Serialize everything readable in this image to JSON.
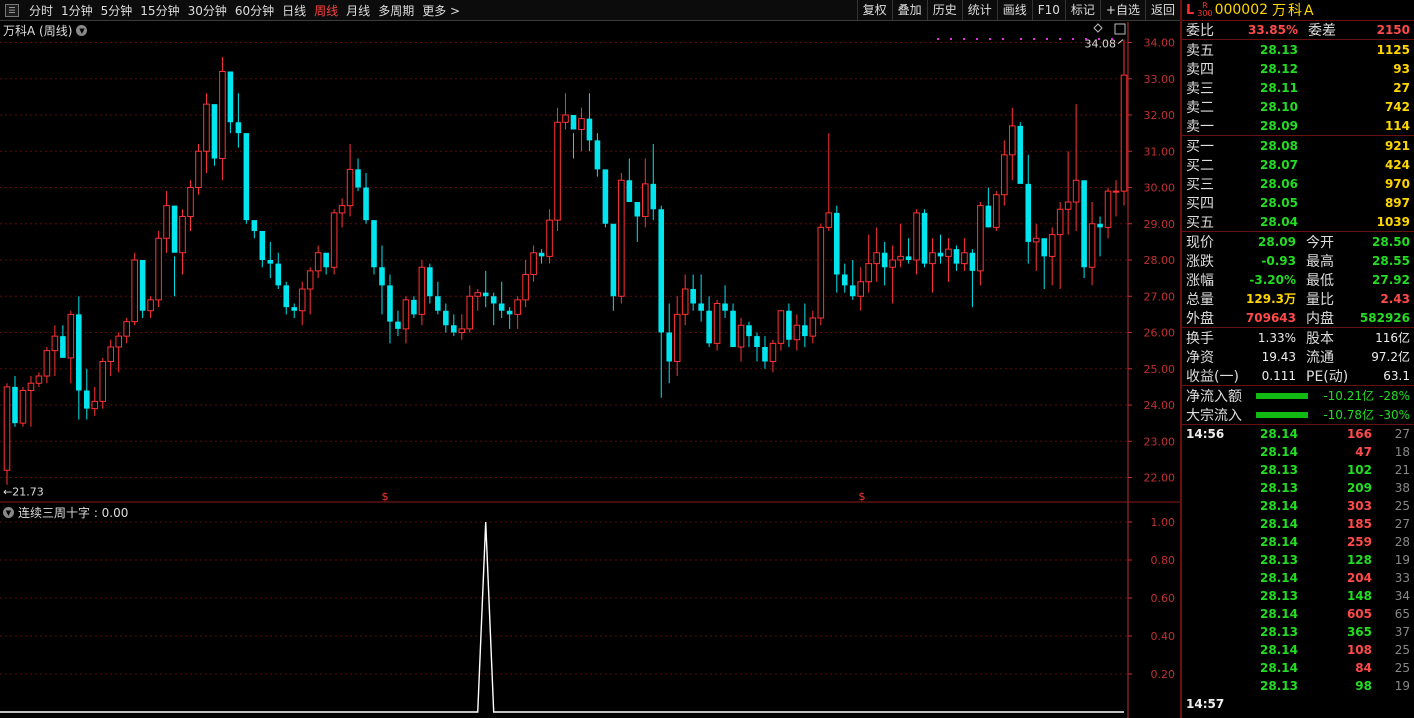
{
  "toolbar": {
    "periods": [
      "分时",
      "1分钟",
      "5分钟",
      "15分钟",
      "30分钟",
      "60分钟",
      "日线",
      "周线",
      "月线",
      "多周期",
      "更多 >"
    ],
    "active_period": 7,
    "tools": [
      "复权",
      "叠加",
      "历史",
      "统计",
      "画线",
      "F10",
      "标记",
      "+自选",
      "返回"
    ]
  },
  "chart": {
    "title": "万科A (周线)",
    "high_label": "34.08",
    "low_label": "←21.73",
    "marker": "$",
    "indicator_title": "连续三周十字 : 0.00"
  },
  "colors": {
    "up": "#ff3333",
    "down": "#00e5ee",
    "grid": "#5a0c0c",
    "axis": "#c03030",
    "ind_line": "#ffffff"
  },
  "chart_data": [
    {
      "type": "candlestick",
      "yticks": [
        "34.00",
        "33.00",
        "32.00",
        "31.00",
        "30.00",
        "29.00",
        "28.00",
        "27.00",
        "26.00",
        "25.00",
        "24.00",
        "23.00",
        "22.00"
      ],
      "ylim": [
        21.73,
        34.08
      ],
      "ohlc": [
        [
          22.2,
          24.6,
          21.8,
          24.5
        ],
        [
          24.5,
          24.8,
          23.4,
          23.5
        ],
        [
          23.5,
          24.5,
          23.4,
          24.4
        ],
        [
          24.4,
          24.8,
          23.4,
          24.6
        ],
        [
          24.6,
          24.9,
          24.5,
          24.8
        ],
        [
          24.8,
          25.6,
          24.6,
          25.5
        ],
        [
          25.5,
          26.2,
          24.8,
          25.9
        ],
        [
          25.9,
          26.2,
          25.6,
          25.3
        ],
        [
          25.3,
          26.6,
          24.6,
          26.5
        ],
        [
          26.5,
          27.0,
          23.6,
          24.4
        ],
        [
          24.4,
          25.0,
          23.6,
          23.9
        ],
        [
          23.9,
          24.5,
          23.7,
          24.1
        ],
        [
          24.1,
          25.3,
          23.9,
          25.2
        ],
        [
          25.2,
          25.8,
          24.8,
          25.6
        ],
        [
          25.6,
          26.0,
          24.9,
          25.9
        ],
        [
          25.9,
          26.4,
          25.7,
          26.3
        ],
        [
          26.3,
          28.2,
          26.2,
          28.0
        ],
        [
          28.0,
          27.4,
          26.4,
          26.6
        ],
        [
          26.6,
          27.0,
          26.4,
          26.9
        ],
        [
          26.9,
          28.8,
          26.7,
          28.6
        ],
        [
          28.6,
          29.9,
          28.2,
          29.5
        ],
        [
          29.5,
          28.1,
          27.0,
          28.2
        ],
        [
          28.2,
          29.4,
          27.6,
          29.2
        ],
        [
          29.2,
          30.2,
          28.8,
          30.0
        ],
        [
          30.0,
          31.2,
          29.8,
          31.0
        ],
        [
          31.0,
          32.6,
          30.4,
          32.3
        ],
        [
          32.3,
          31.9,
          30.6,
          30.8
        ],
        [
          30.8,
          33.6,
          30.2,
          33.2
        ],
        [
          33.2,
          32.0,
          31.5,
          31.8
        ],
        [
          31.8,
          32.6,
          31.1,
          31.5
        ],
        [
          31.5,
          31.2,
          29.0,
          29.1
        ],
        [
          29.1,
          28.9,
          28.6,
          28.8
        ],
        [
          28.8,
          28.4,
          27.8,
          28.0
        ],
        [
          28.0,
          28.5,
          27.5,
          27.9
        ],
        [
          27.9,
          28.2,
          27.2,
          27.3
        ],
        [
          27.3,
          27.4,
          26.5,
          26.7
        ],
        [
          26.7,
          26.8,
          26.4,
          26.6
        ],
        [
          26.6,
          27.4,
          26.2,
          27.2
        ],
        [
          27.2,
          27.8,
          26.5,
          27.7
        ],
        [
          27.7,
          28.4,
          27.5,
          28.2
        ],
        [
          28.2,
          28.1,
          27.6,
          27.8
        ],
        [
          27.8,
          29.4,
          27.6,
          29.3
        ],
        [
          29.3,
          29.7,
          28.9,
          29.5
        ],
        [
          29.5,
          31.2,
          29.2,
          30.5
        ],
        [
          30.5,
          30.8,
          29.9,
          30.0
        ],
        [
          30.0,
          30.4,
          29.0,
          29.1
        ],
        [
          29.1,
          28.8,
          27.6,
          27.8
        ],
        [
          27.8,
          28.4,
          26.5,
          27.3
        ],
        [
          27.3,
          27.6,
          25.7,
          26.3
        ],
        [
          26.3,
          26.6,
          25.9,
          26.1
        ],
        [
          26.1,
          27.0,
          25.7,
          26.9
        ],
        [
          26.9,
          27.0,
          26.4,
          26.5
        ],
        [
          26.5,
          28.0,
          26.2,
          27.8
        ],
        [
          27.8,
          27.9,
          26.8,
          27.0
        ],
        [
          27.0,
          27.4,
          26.5,
          26.6
        ],
        [
          26.6,
          26.8,
          26.0,
          26.2
        ],
        [
          26.2,
          26.5,
          25.9,
          26.0
        ],
        [
          26.0,
          26.5,
          25.8,
          26.1
        ],
        [
          26.1,
          27.3,
          26.0,
          27.0
        ],
        [
          27.0,
          27.2,
          26.6,
          27.1
        ],
        [
          27.1,
          27.7,
          26.7,
          27.0
        ],
        [
          27.0,
          27.1,
          26.2,
          26.8
        ],
        [
          26.8,
          27.4,
          26.4,
          26.6
        ],
        [
          26.6,
          26.7,
          26.1,
          26.5
        ],
        [
          26.5,
          27.0,
          26.1,
          26.9
        ],
        [
          26.9,
          28.0,
          26.7,
          27.6
        ],
        [
          27.6,
          28.4,
          27.4,
          28.2
        ],
        [
          28.2,
          28.3,
          27.9,
          28.1
        ],
        [
          28.1,
          29.4,
          27.9,
          29.1
        ],
        [
          29.1,
          32.2,
          28.8,
          31.8
        ],
        [
          31.8,
          32.6,
          31.6,
          32.0
        ],
        [
          32.0,
          31.5,
          30.8,
          31.6
        ],
        [
          31.6,
          32.2,
          31.0,
          31.9
        ],
        [
          31.9,
          32.6,
          31.0,
          31.3
        ],
        [
          31.3,
          31.5,
          30.3,
          30.5
        ],
        [
          30.5,
          29.4,
          28.9,
          29.0
        ],
        [
          29.0,
          28.7,
          26.6,
          27.0
        ],
        [
          27.0,
          30.4,
          26.8,
          30.2
        ],
        [
          30.2,
          30.8,
          29.6,
          29.6
        ],
        [
          29.6,
          29.4,
          28.5,
          29.2
        ],
        [
          29.2,
          30.8,
          28.9,
          30.1
        ],
        [
          30.1,
          31.2,
          29.1,
          29.4
        ],
        [
          29.4,
          29.5,
          24.2,
          26.0
        ],
        [
          26.0,
          26.8,
          24.6,
          25.2
        ],
        [
          25.2,
          27.0,
          24.8,
          26.5
        ],
        [
          26.5,
          27.6,
          26.2,
          27.2
        ],
        [
          27.2,
          27.6,
          26.6,
          26.8
        ],
        [
          26.8,
          27.6,
          26.3,
          26.6
        ],
        [
          26.6,
          27.0,
          25.6,
          25.7
        ],
        [
          25.7,
          26.9,
          25.5,
          26.8
        ],
        [
          26.8,
          27.3,
          26.4,
          26.6
        ],
        [
          26.6,
          26.8,
          25.6,
          25.6
        ],
        [
          25.6,
          26.4,
          25.2,
          26.2
        ],
        [
          26.2,
          26.3,
          25.6,
          25.9
        ],
        [
          25.9,
          26.0,
          25.2,
          25.6
        ],
        [
          25.6,
          25.9,
          25.0,
          25.2
        ],
        [
          25.2,
          25.8,
          24.9,
          25.7
        ],
        [
          25.7,
          26.6,
          25.5,
          26.6
        ],
        [
          26.6,
          26.8,
          25.6,
          25.8
        ],
        [
          25.8,
          26.5,
          25.5,
          26.2
        ],
        [
          26.2,
          26.8,
          25.6,
          25.9
        ],
        [
          25.9,
          26.6,
          25.7,
          26.4
        ],
        [
          26.4,
          29.0,
          26.2,
          28.9
        ],
        [
          28.9,
          31.5,
          28.8,
          29.3
        ],
        [
          29.3,
          29.5,
          27.1,
          27.6
        ],
        [
          27.6,
          27.9,
          27.1,
          27.3
        ],
        [
          27.3,
          28.0,
          26.9,
          27.0
        ],
        [
          27.0,
          27.8,
          26.6,
          27.4
        ],
        [
          27.4,
          28.7,
          27.1,
          27.9
        ],
        [
          27.9,
          28.9,
          27.4,
          28.2
        ],
        [
          28.2,
          28.5,
          27.3,
          27.8
        ],
        [
          27.8,
          28.4,
          26.8,
          28.0
        ],
        [
          28.0,
          29.0,
          27.8,
          28.1
        ],
        [
          28.1,
          28.6,
          27.9,
          28.0
        ],
        [
          28.0,
          29.4,
          27.6,
          29.3
        ],
        [
          29.3,
          29.4,
          27.8,
          27.9
        ],
        [
          27.9,
          28.6,
          27.1,
          28.2
        ],
        [
          28.2,
          28.7,
          27.9,
          28.1
        ],
        [
          28.1,
          28.6,
          27.4,
          28.3
        ],
        [
          28.3,
          28.4,
          27.7,
          27.9
        ],
        [
          27.9,
          28.6,
          27.7,
          28.2
        ],
        [
          28.2,
          28.3,
          26.7,
          27.7
        ],
        [
          27.7,
          29.6,
          27.3,
          29.5
        ],
        [
          29.5,
          30.0,
          28.9,
          28.9
        ],
        [
          28.9,
          29.9,
          28.8,
          29.8
        ],
        [
          29.8,
          31.3,
          29.5,
          30.9
        ],
        [
          30.9,
          32.2,
          30.2,
          31.7
        ],
        [
          31.7,
          31.8,
          30.2,
          30.1
        ],
        [
          30.1,
          30.9,
          27.9,
          28.5
        ],
        [
          28.5,
          29.0,
          27.7,
          28.6
        ],
        [
          28.6,
          28.3,
          27.2,
          28.1
        ],
        [
          28.1,
          28.9,
          27.3,
          28.7
        ],
        [
          28.7,
          29.6,
          27.2,
          29.4
        ],
        [
          29.4,
          31.0,
          28.7,
          29.6
        ],
        [
          29.6,
          32.3,
          28.8,
          30.2
        ],
        [
          30.2,
          29.0,
          27.5,
          27.8
        ],
        [
          27.8,
          29.6,
          27.3,
          29.0
        ],
        [
          29.0,
          29.2,
          28.1,
          28.9
        ],
        [
          28.9,
          30.0,
          28.6,
          29.9
        ],
        [
          29.9,
          30.2,
          29.2,
          29.9
        ],
        [
          29.9,
          34.08,
          29.5,
          33.1
        ]
      ]
    },
    {
      "type": "line",
      "name": "连续三周十字",
      "yticks": [
        "1.00",
        "0.80",
        "0.60",
        "0.40",
        "0.20"
      ],
      "ylim": [
        0,
        1
      ],
      "spike_index": 60,
      "spike_value": 1.0
    }
  ],
  "panel": {
    "code": "000002",
    "name": "万科A",
    "top_letter": "L",
    "tag": "R",
    "tag_num": "300",
    "weibi_label": "委比",
    "weibi": "33.85%",
    "weicha_label": "委差",
    "weicha": "2150",
    "sells": [
      {
        "label": "卖五",
        "price": "28.13",
        "vol": "1125"
      },
      {
        "label": "卖四",
        "price": "28.12",
        "vol": "93"
      },
      {
        "label": "卖三",
        "price": "28.11",
        "vol": "27"
      },
      {
        "label": "卖二",
        "price": "28.10",
        "vol": "742"
      },
      {
        "label": "卖一",
        "price": "28.09",
        "vol": "114"
      }
    ],
    "buys": [
      {
        "label": "买一",
        "price": "28.08",
        "vol": "921"
      },
      {
        "label": "买二",
        "price": "28.07",
        "vol": "424"
      },
      {
        "label": "买三",
        "price": "28.06",
        "vol": "970"
      },
      {
        "label": "买四",
        "price": "28.05",
        "vol": "897"
      },
      {
        "label": "买五",
        "price": "28.04",
        "vol": "1039"
      }
    ],
    "quote": [
      {
        "l1": "现价",
        "v1": "28.09",
        "c1": "green",
        "l2": "今开",
        "v2": "28.50",
        "c2": "green"
      },
      {
        "l1": "涨跌",
        "v1": "-0.93",
        "c1": "green",
        "l2": "最高",
        "v2": "28.55",
        "c2": "green"
      },
      {
        "l1": "涨幅",
        "v1": "-3.20%",
        "c1": "green",
        "l2": "最低",
        "v2": "27.92",
        "c2": "green"
      },
      {
        "l1": "总量",
        "v1": "129.3万",
        "c1": "yellow",
        "l2": "量比",
        "v2": "2.43",
        "c2": "red"
      },
      {
        "l1": "外盘",
        "v1": "709643",
        "c1": "red",
        "l2": "内盘",
        "v2": "582926",
        "c2": "green"
      }
    ],
    "fund": [
      {
        "l1": "换手",
        "v1": "1.33%",
        "l2": "股本",
        "v2": "116亿"
      },
      {
        "l1": "净资",
        "v1": "19.43",
        "l2": "流通",
        "v2": "97.2亿"
      },
      {
        "l1": "收益(一)",
        "v1": "0.111",
        "l2": "PE(动)",
        "v2": "63.1"
      }
    ],
    "flows": [
      {
        "label": "净流入额",
        "value": "-10.21亿",
        "pct": "-28%"
      },
      {
        "label": "大宗流入",
        "value": "-10.78亿",
        "pct": "-30%"
      }
    ],
    "tick_time": "14:56",
    "tick_time2": "14:57",
    "ticks": [
      {
        "p": "28.14",
        "v": "166",
        "c": "red",
        "n": "27"
      },
      {
        "p": "28.14",
        "v": "47",
        "c": "red",
        "n": "18"
      },
      {
        "p": "28.13",
        "v": "102",
        "c": "green",
        "n": "21"
      },
      {
        "p": "28.13",
        "v": "209",
        "c": "green",
        "n": "38"
      },
      {
        "p": "28.14",
        "v": "303",
        "c": "red",
        "n": "25"
      },
      {
        "p": "28.14",
        "v": "185",
        "c": "red",
        "n": "27"
      },
      {
        "p": "28.14",
        "v": "259",
        "c": "red",
        "n": "28"
      },
      {
        "p": "28.13",
        "v": "128",
        "c": "green",
        "n": "19"
      },
      {
        "p": "28.14",
        "v": "204",
        "c": "red",
        "n": "33"
      },
      {
        "p": "28.13",
        "v": "148",
        "c": "green",
        "n": "34"
      },
      {
        "p": "28.14",
        "v": "605",
        "c": "red",
        "n": "65"
      },
      {
        "p": "28.13",
        "v": "365",
        "c": "green",
        "n": "37"
      },
      {
        "p": "28.14",
        "v": "108",
        "c": "red",
        "n": "25"
      },
      {
        "p": "28.14",
        "v": "84",
        "c": "red",
        "n": "25"
      },
      {
        "p": "28.13",
        "v": "98",
        "c": "green",
        "n": "19"
      }
    ]
  }
}
